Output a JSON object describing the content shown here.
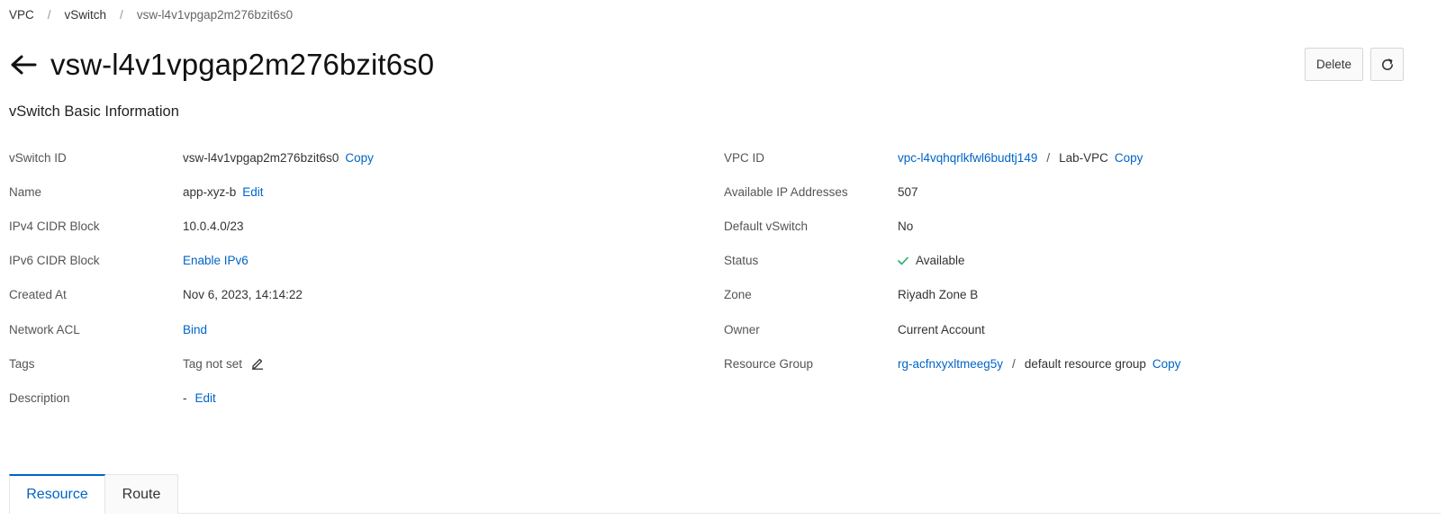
{
  "breadcrumb": {
    "items": [
      "VPC",
      "vSwitch",
      "vsw-l4v1vpgap2m276bzit6s0"
    ],
    "separator": "/"
  },
  "header": {
    "title": "vsw-l4v1vpgap2m276bzit6s0",
    "back_icon": "arrow-left-icon",
    "delete_label": "Delete",
    "refresh_icon": "refresh-icon"
  },
  "section": {
    "title": "vSwitch Basic Information"
  },
  "left": {
    "vswitch_id": {
      "label": "vSwitch ID",
      "value": "vsw-l4v1vpgap2m276bzit6s0",
      "action": "Copy"
    },
    "name": {
      "label": "Name",
      "value": "app-xyz-b",
      "action": "Edit"
    },
    "ipv4": {
      "label": "IPv4 CIDR Block",
      "value": "10.0.4.0/23"
    },
    "ipv6": {
      "label": "IPv6 CIDR Block",
      "action": "Enable IPv6"
    },
    "created": {
      "label": "Created At",
      "value": "Nov 6, 2023, 14:14:22"
    },
    "acl": {
      "label": "Network ACL",
      "action": "Bind"
    },
    "tags": {
      "label": "Tags",
      "value": "Tag not set",
      "icon": "edit-pencil-icon"
    },
    "description": {
      "label": "Description",
      "value": "-",
      "action": "Edit"
    }
  },
  "right": {
    "vpc_id": {
      "label": "VPC ID",
      "link": "vpc-l4vqhqrlkfwl6budtj149",
      "separator": "/",
      "name": "Lab-VPC",
      "action": "Copy"
    },
    "available_ips": {
      "label": "Available IP Addresses",
      "value": "507"
    },
    "default_vswitch": {
      "label": "Default vSwitch",
      "value": "No"
    },
    "status": {
      "label": "Status",
      "value": "Available",
      "icon": "check-icon"
    },
    "zone": {
      "label": "Zone",
      "value": "Riyadh Zone B"
    },
    "owner": {
      "label": "Owner",
      "value": "Current Account"
    },
    "resource_group": {
      "label": "Resource Group",
      "link": "rg-acfnxyxltmeeg5y",
      "separator": "/",
      "name": "default resource group",
      "action": "Copy"
    }
  },
  "tabs": [
    {
      "label": "Resource",
      "active": true
    },
    {
      "label": "Route",
      "active": false
    }
  ],
  "colors": {
    "link": "#0064c8",
    "success": "#23b066",
    "border": "#e5e5e5"
  }
}
